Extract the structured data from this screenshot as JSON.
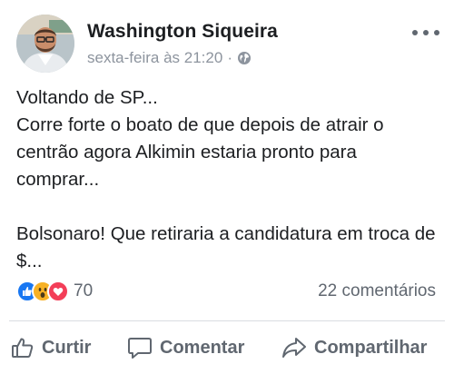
{
  "post": {
    "author": "Washington Siqueira",
    "timestamp": "sexta-feira às 21:20",
    "separator": "·",
    "audience_icon": "globe-icon",
    "paragraphs": [
      "Voltando de SP...\nCorre forte o boato de que depois de atrair o centrão agora Alkimin estaria pronto para comprar...",
      "Bolsonaro! Que retiraria a candidatura em troca de $..."
    ]
  },
  "stats": {
    "reactions": [
      "like",
      "wow",
      "love"
    ],
    "reaction_count": "70",
    "comments": "22 comentários"
  },
  "actions": {
    "like": "Curtir",
    "comment": "Comentar",
    "share": "Compartilhar"
  },
  "colors": {
    "like_blue": "#1877f2",
    "wow_yellow": "#f7b125",
    "love_red": "#f33e58",
    "secondary_text": "#606770"
  }
}
